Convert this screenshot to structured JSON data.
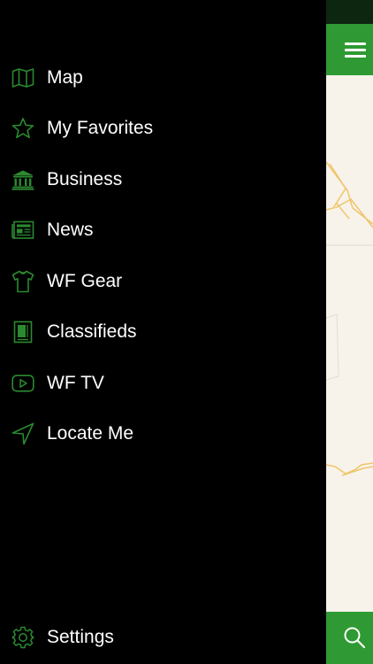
{
  "colors": {
    "accent_green": "#2f9a33",
    "icon_green": "#2b8a2f",
    "drawer_bg": "#000000",
    "map_bg": "#f7f3ea",
    "map_road": "#f0c56c"
  },
  "menu": {
    "items": [
      {
        "label": "Map",
        "icon": "map-icon"
      },
      {
        "label": "My Favorites",
        "icon": "star-icon"
      },
      {
        "label": "Business",
        "icon": "bank-icon"
      },
      {
        "label": "News",
        "icon": "newspaper-icon"
      },
      {
        "label": "WF Gear",
        "icon": "shirt-icon"
      },
      {
        "label": "Classifieds",
        "icon": "document-icon"
      },
      {
        "label": "WF TV",
        "icon": "play-icon"
      },
      {
        "label": "Locate Me",
        "icon": "location-arrow-icon"
      }
    ],
    "settings": {
      "label": "Settings",
      "icon": "gear-icon"
    }
  },
  "map_panel": {
    "menu_icon": "hamburger-icon",
    "search_icon": "search-icon"
  }
}
